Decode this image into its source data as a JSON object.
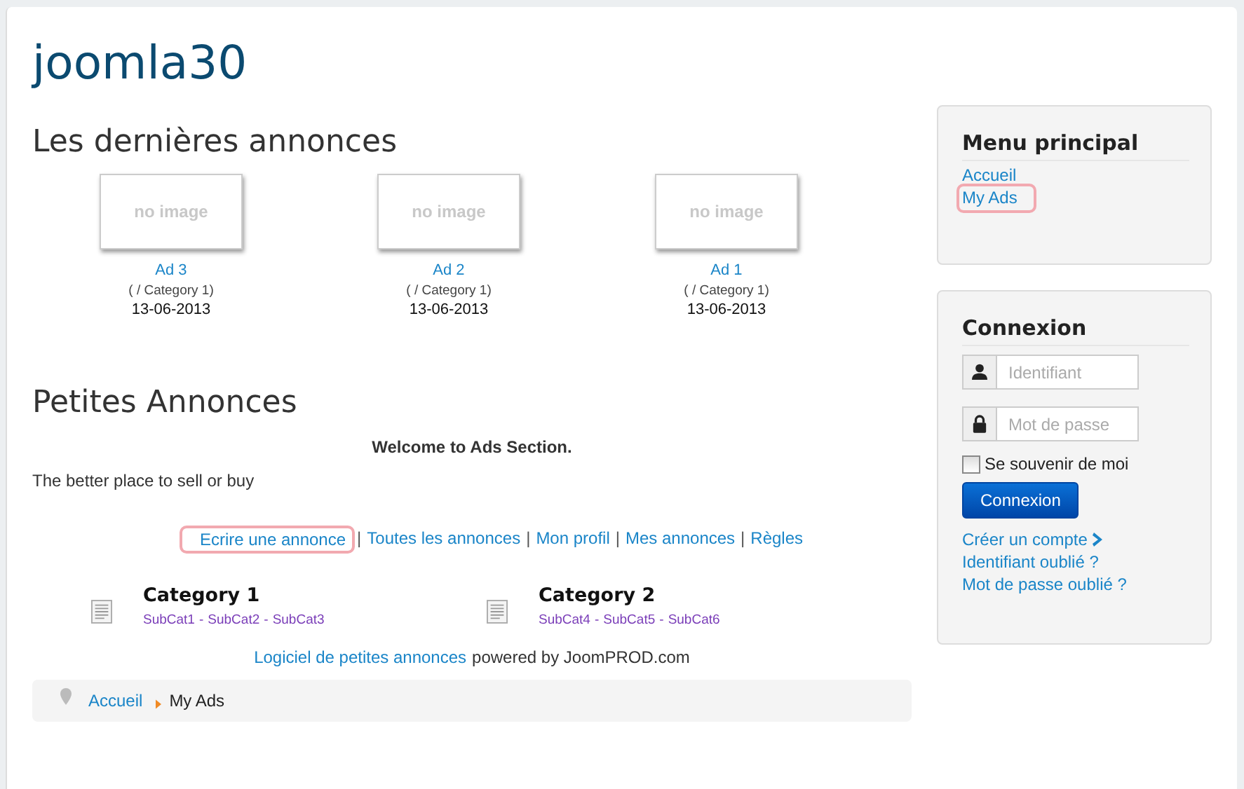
{
  "site_title": "joomla30",
  "latest": {
    "heading": "Les dernières annonces",
    "ads": [
      {
        "image_text": "no image",
        "title": "Ad 3",
        "category": "( / Category 1)",
        "date": "13-06-2013"
      },
      {
        "image_text": "no image",
        "title": "Ad 2",
        "category": "( / Category 1)",
        "date": "13-06-2013"
      },
      {
        "image_text": "no image",
        "title": "Ad 1",
        "category": "( / Category 1)",
        "date": "13-06-2013"
      }
    ]
  },
  "classifieds": {
    "heading": "Petites Annonces",
    "welcome": "Welcome to Ads Section.",
    "tagline": "The better place to sell or buy",
    "separator": "|",
    "links": [
      {
        "label": "Ecrire une annonce",
        "highlighted": true
      },
      {
        "label": "Toutes les annonces",
        "highlighted": false
      },
      {
        "label": "Mon profil",
        "highlighted": false
      },
      {
        "label": "Mes annonces",
        "highlighted": false
      },
      {
        "label": "Règles",
        "highlighted": false
      }
    ],
    "subcat_separator": "-",
    "categories": [
      {
        "name": "Category 1",
        "subcats": [
          "SubCat1",
          "SubCat2",
          "SubCat3"
        ]
      },
      {
        "name": "Category 2",
        "subcats": [
          "SubCat4",
          "SubCat5",
          "SubCat6"
        ]
      }
    ],
    "footer_link": "Logiciel de petites annonces",
    "footer_text": "powered by JoomPROD.com"
  },
  "breadcrumb": [
    {
      "label": "Accueil",
      "link": true
    },
    {
      "label": "My Ads",
      "link": false
    }
  ],
  "menu": {
    "title": "Menu principal",
    "items": [
      {
        "label": "Accueil",
        "highlighted": false
      },
      {
        "label": "My Ads",
        "highlighted": true
      }
    ]
  },
  "login": {
    "title": "Connexion",
    "username_placeholder": "Identifiant",
    "password_placeholder": "Mot de passe",
    "remember_label": "Se souvenir de moi",
    "remember_checked": false,
    "submit": "Connexion",
    "links": [
      {
        "label": "Créer un compte",
        "chevron": true
      },
      {
        "label": "Identifiant oublié ?",
        "chevron": false
      },
      {
        "label": "Mot de passe oublié ?",
        "chevron": false
      }
    ]
  }
}
